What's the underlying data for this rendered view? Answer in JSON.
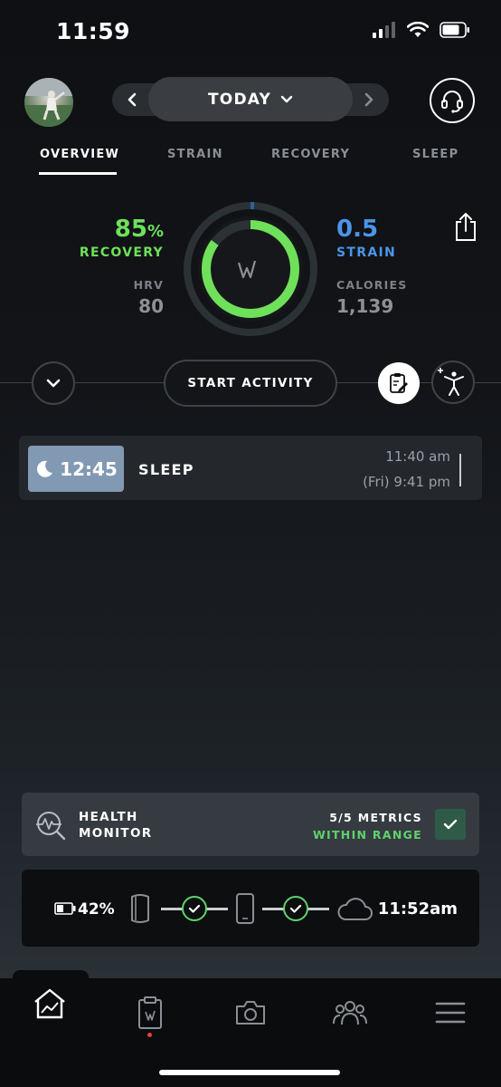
{
  "status_bar": {
    "time": "11:59"
  },
  "header": {
    "date_label": "TODAY"
  },
  "tabs": [
    {
      "label": "OVERVIEW",
      "active": true
    },
    {
      "label": "STRAIN",
      "active": false
    },
    {
      "label": "RECOVERY",
      "active": false
    },
    {
      "label": "SLEEP",
      "active": false
    }
  ],
  "recovery": {
    "value": "85",
    "unit": "%",
    "label": "RECOVERY",
    "percent": 85,
    "color": "#6fe05a"
  },
  "hrv": {
    "label": "HRV",
    "value": "80"
  },
  "strain": {
    "value": "0.5",
    "label": "STRAIN",
    "color": "#4b95e8"
  },
  "calories": {
    "label": "CALORIES",
    "value": "1,139"
  },
  "actions": {
    "start_activity": "START ACTIVITY"
  },
  "sleep": {
    "duration": "12:45",
    "title": "SLEEP",
    "end_time": "11:40 am",
    "start_time": "(Fri) 9:41 pm"
  },
  "health_monitor": {
    "line1": "HEALTH",
    "line2": "MONITOR",
    "metrics": "5/5 METRICS",
    "status": "WITHIN RANGE",
    "status_color": "#5fd26c"
  },
  "sync": {
    "battery": "42%",
    "last_sync": "11:52am"
  }
}
